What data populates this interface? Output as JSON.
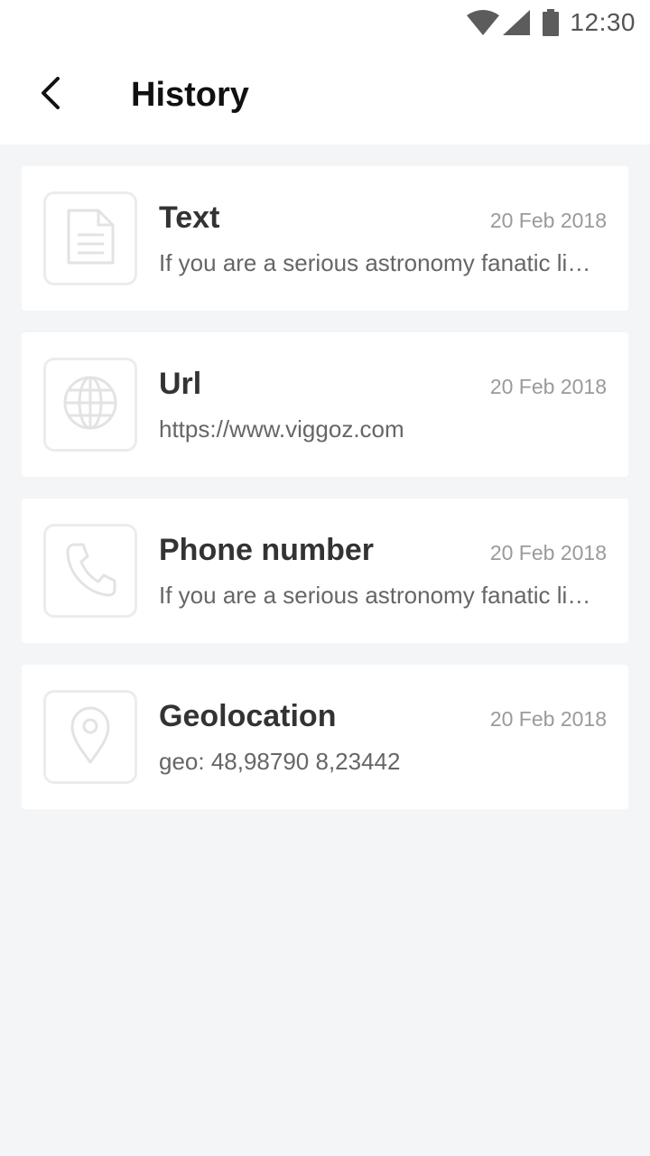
{
  "status_bar": {
    "time": "12:30",
    "icons": [
      "wifi-icon",
      "signal-icon",
      "battery-icon"
    ]
  },
  "header": {
    "back_icon": "chevron-left-icon",
    "title": "History"
  },
  "history": [
    {
      "type": "Text",
      "icon": "document-icon",
      "date": "20 Feb 2018",
      "preview": "If you are a serious astronomy fanatic like a lot of us are, you can probably remember that one event"
    },
    {
      "type": "Url",
      "icon": "globe-icon",
      "date": "20 Feb 2018",
      "preview": "https://www.viggoz.com"
    },
    {
      "type": "Phone number",
      "icon": "phone-icon",
      "date": "20 Feb 2018",
      "preview": "If you are a serious astronomy fanatic like a lot of us are, you can probably remember that one event"
    },
    {
      "type": "Geolocation",
      "icon": "map-pin-icon",
      "date": "20 Feb 2018",
      "preview": "geo: 48,98790 8,23442"
    }
  ],
  "colors": {
    "background": "#f4f5f7",
    "card": "#ffffff",
    "icon_stroke": "#e3e3e3",
    "title_text": "#333333",
    "date_text": "#9a9a9a"
  }
}
